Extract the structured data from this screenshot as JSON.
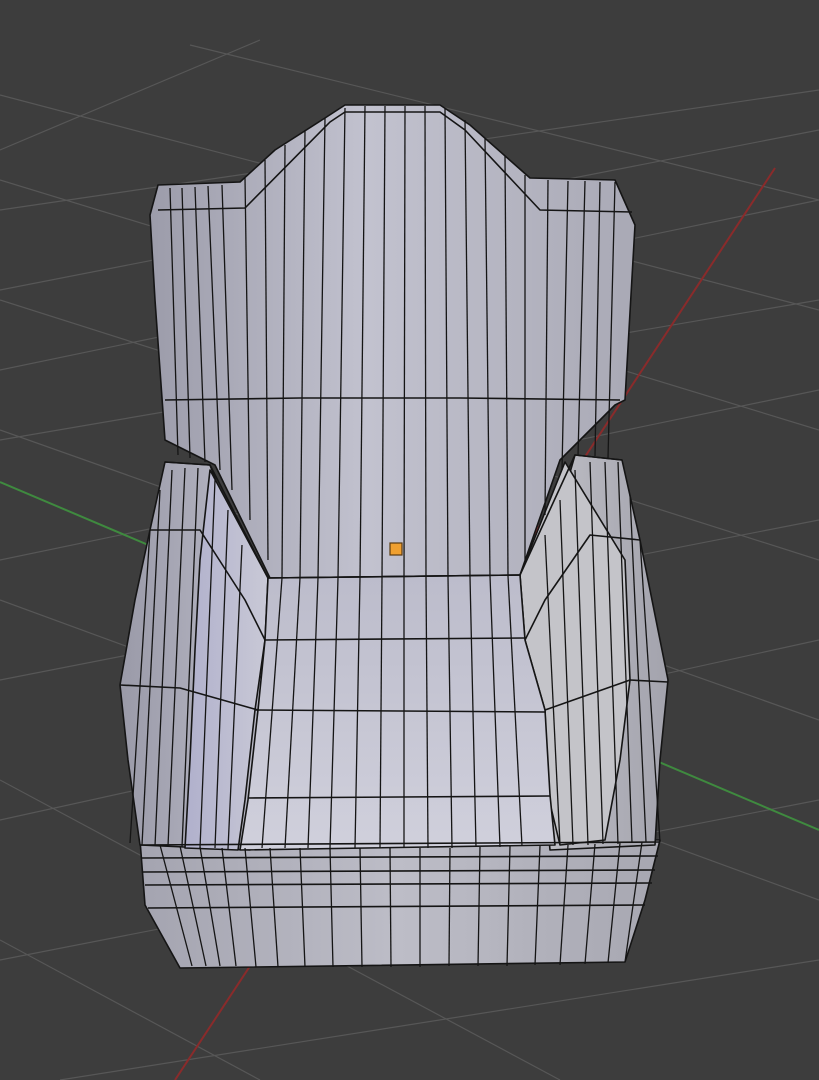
{
  "viewport": {
    "background": "#3d3d3d",
    "grid_color": "#575757",
    "x_axis_color": "#8a2b2b",
    "y_axis_color": "#3f8a3f"
  },
  "object": {
    "shape": "armchair-wireframe-mesh",
    "fill_color": "#b8b8c6",
    "edge_color": "#151515",
    "origin_color": "#f0a030"
  }
}
